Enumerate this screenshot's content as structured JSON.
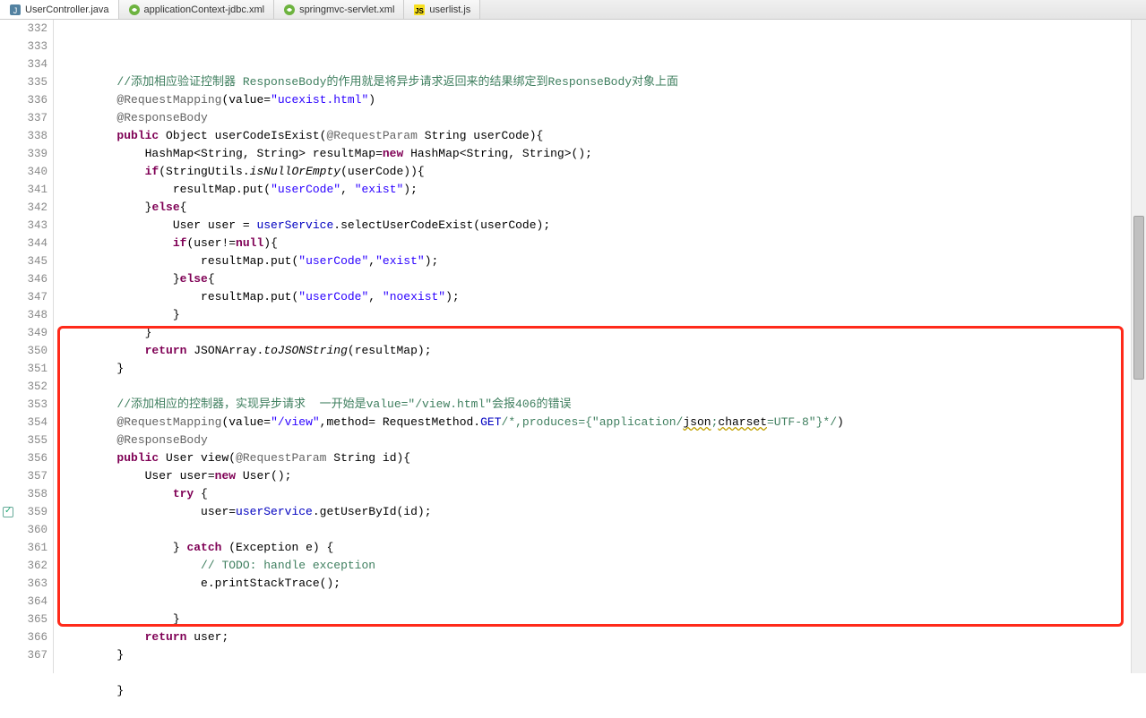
{
  "tabs": [
    {
      "label": "UserController.java",
      "active": true,
      "icon": "java"
    },
    {
      "label": "applicationContext-jdbc.xml",
      "active": false,
      "icon": "spring"
    },
    {
      "label": "springmvc-servlet.xml",
      "active": false,
      "icon": "spring"
    },
    {
      "label": "userlist.js",
      "active": false,
      "icon": "js"
    }
  ],
  "startLine": 332,
  "endLine": 367,
  "markerLine": 359,
  "highlight": {
    "fromLine": 349,
    "toLine": 365
  },
  "code": {
    "332": [
      [
        "cm",
        "//添加相应验证控制器 ResponseBody的作用就是将异步请求返回来的结果绑定到ResponseBody对象上面"
      ]
    ],
    "333": [
      [
        "ann",
        "@RequestMapping"
      ],
      [
        "id",
        "(value="
      ],
      [
        "str",
        "\"ucexist.html\""
      ],
      [
        "id",
        ")"
      ]
    ],
    "334": [
      [
        "ann",
        "@ResponseBody"
      ]
    ],
    "335": [
      [
        "kw",
        "public"
      ],
      [
        "id",
        " Object userCodeIsExist("
      ],
      [
        "ann",
        "@RequestParam"
      ],
      [
        "id",
        " String userCode){"
      ]
    ],
    "336": [
      [
        "id",
        "    HashMap<String, String> resultMap="
      ],
      [
        "kw",
        "new"
      ],
      [
        "id",
        " HashMap<String, String>();"
      ]
    ],
    "337": [
      [
        "kw",
        "    if"
      ],
      [
        "id",
        "(StringUtils."
      ],
      [
        "mtd-static",
        "isNullOrEmpty"
      ],
      [
        "id",
        "(userCode)){"
      ]
    ],
    "338": [
      [
        "id",
        "        resultMap.put("
      ],
      [
        "str",
        "\"userCode\""
      ],
      [
        "id",
        ", "
      ],
      [
        "str",
        "\"exist\""
      ],
      [
        "id",
        ");"
      ]
    ],
    "339": [
      [
        "id",
        "    }"
      ],
      [
        "kw",
        "else"
      ],
      [
        "id",
        "{"
      ]
    ],
    "340": [
      [
        "id",
        "        User user = "
      ],
      [
        "fld",
        "userService"
      ],
      [
        "id",
        ".selectUserCodeExist(userCode);"
      ]
    ],
    "341": [
      [
        "kw",
        "        if"
      ],
      [
        "id",
        "(user!="
      ],
      [
        "kw",
        "null"
      ],
      [
        "id",
        "){"
      ]
    ],
    "342": [
      [
        "id",
        "            resultMap.put("
      ],
      [
        "str",
        "\"userCode\""
      ],
      [
        "id",
        ","
      ],
      [
        "str",
        "\"exist\""
      ],
      [
        "id",
        ");"
      ]
    ],
    "343": [
      [
        "id",
        "        }"
      ],
      [
        "kw",
        "else"
      ],
      [
        "id",
        "{"
      ]
    ],
    "344": [
      [
        "id",
        "            resultMap.put("
      ],
      [
        "str",
        "\"userCode\""
      ],
      [
        "id",
        ", "
      ],
      [
        "str",
        "\"noexist\""
      ],
      [
        "id",
        ");"
      ]
    ],
    "345": [
      [
        "id",
        "        }"
      ]
    ],
    "346": [
      [
        "id",
        "    }"
      ]
    ],
    "347": [
      [
        "kw",
        "    return"
      ],
      [
        "id",
        " JSONArray."
      ],
      [
        "mtd-static",
        "toJSONString"
      ],
      [
        "id",
        "(resultMap);"
      ]
    ],
    "348": [
      [
        "id",
        "}"
      ]
    ],
    "349": [
      [
        "id",
        ""
      ]
    ],
    "350": [
      [
        "cm",
        "//添加相应的控制器，实现异步请求  一开始是value=\"/view.html\"会报406的错误"
      ]
    ],
    "351": [
      [
        "ann",
        "@RequestMapping"
      ],
      [
        "id",
        "(value="
      ],
      [
        "str",
        "\"/view\""
      ],
      [
        "id",
        ",method= RequestMethod."
      ],
      [
        "fld",
        "GET"
      ],
      [
        "cm",
        "/*,produces={\"application/"
      ],
      [
        "underline",
        "json"
      ],
      [
        "cm",
        ";"
      ],
      [
        "underline",
        "charset"
      ],
      [
        "cm",
        "=UTF-8\"}*/"
      ],
      [
        "id",
        ")"
      ]
    ],
    "352": [
      [
        "ann",
        "@ResponseBody"
      ]
    ],
    "353": [
      [
        "kw",
        "public"
      ],
      [
        "id",
        " User view("
      ],
      [
        "ann",
        "@RequestParam"
      ],
      [
        "id",
        " String id){"
      ]
    ],
    "354": [
      [
        "id",
        "    User user="
      ],
      [
        "kw",
        "new"
      ],
      [
        "id",
        " User();"
      ]
    ],
    "355": [
      [
        "kw",
        "        try"
      ],
      [
        "id",
        " {"
      ]
    ],
    "356": [
      [
        "id",
        "            user="
      ],
      [
        "fld",
        "userService"
      ],
      [
        "id",
        ".getUserById(id);"
      ]
    ],
    "357": [
      [
        "id",
        ""
      ]
    ],
    "358": [
      [
        "id",
        "        } "
      ],
      [
        "kw",
        "catch"
      ],
      [
        "id",
        " (Exception e) {"
      ]
    ],
    "359": [
      [
        "cm",
        "            // "
      ],
      [
        "cm",
        "TODO: handle exception"
      ]
    ],
    "360": [
      [
        "id",
        "            e.printStackTrace();"
      ]
    ],
    "361": [
      [
        "id",
        ""
      ]
    ],
    "362": [
      [
        "id",
        "        }"
      ]
    ],
    "363": [
      [
        "kw",
        "    return"
      ],
      [
        "id",
        " user;"
      ]
    ],
    "364": [
      [
        "id",
        "}"
      ]
    ],
    "365": [
      [
        "id",
        ""
      ]
    ],
    "366": [
      [
        "id",
        "}"
      ]
    ],
    "367": [
      [
        "id",
        ""
      ]
    ]
  },
  "indentBase": "        "
}
